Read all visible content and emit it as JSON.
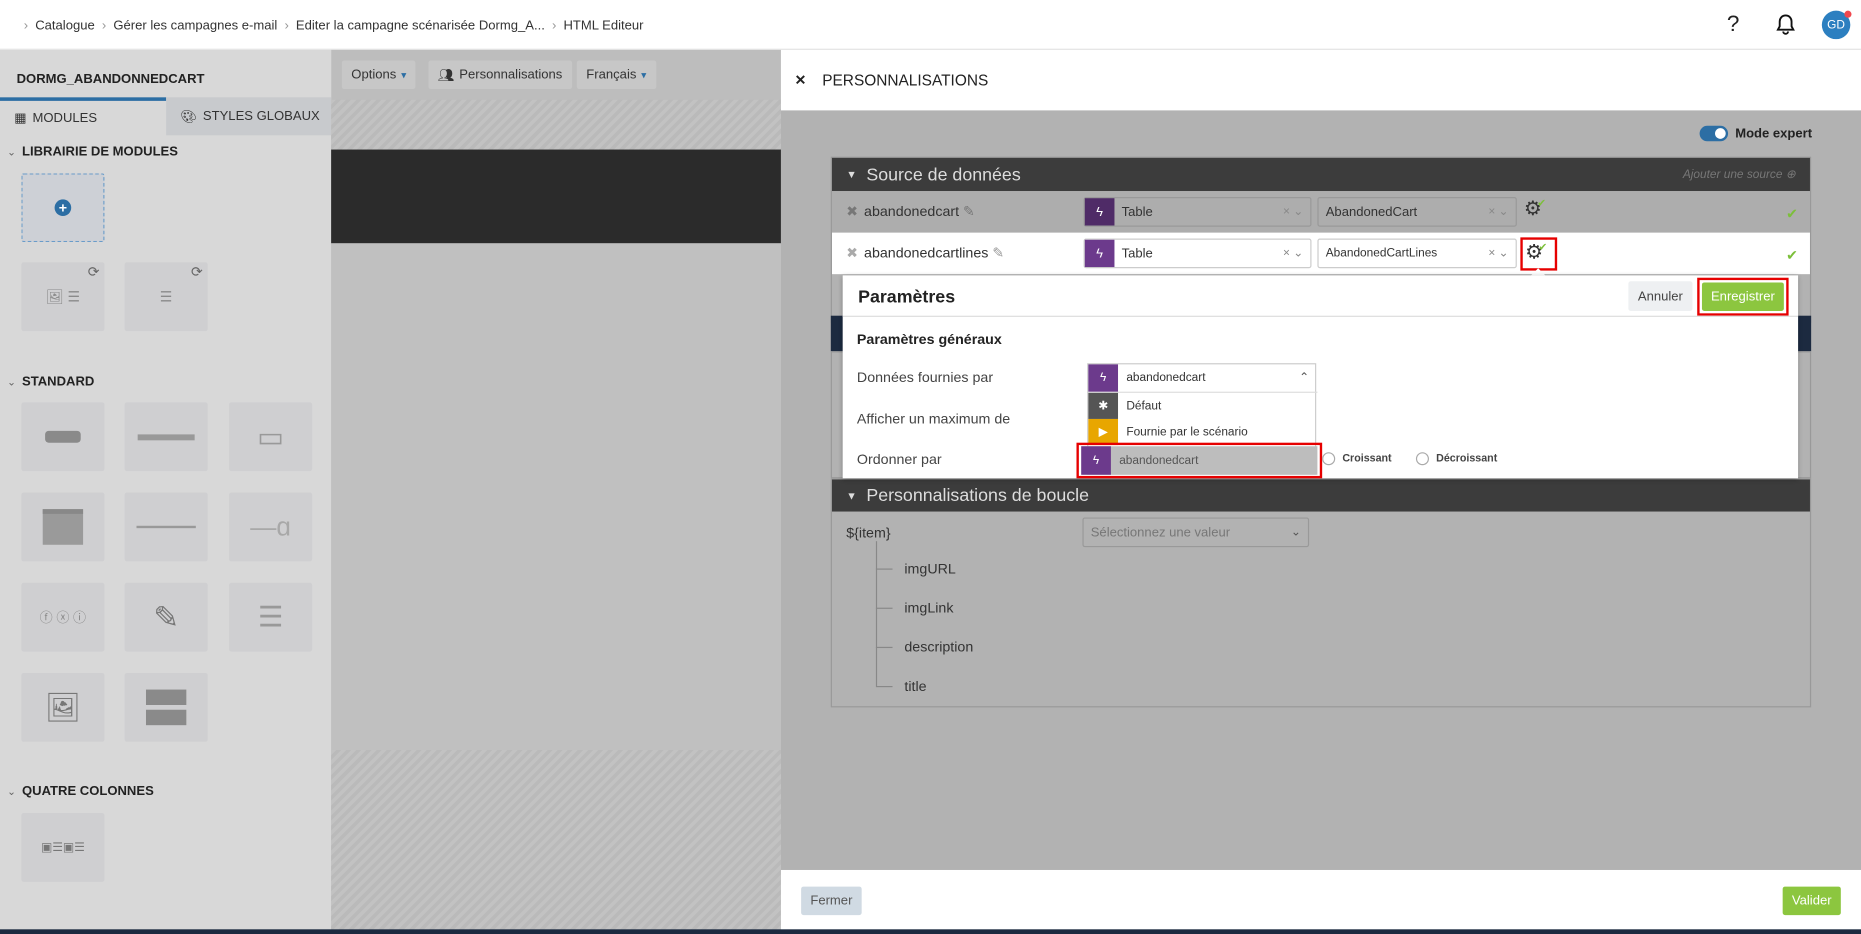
{
  "breadcrumb": [
    "Catalogue",
    "Gérer les campagnes e-mail",
    "Editer la campagne scénarisée Dormg_A...",
    "HTML Editeur"
  ],
  "header": {
    "help_icon": "question-icon",
    "notif_icon": "bell-icon",
    "avatar": "GD"
  },
  "sidebar": {
    "title": "DORMG_ABANDONNEDCART",
    "tabs": [
      {
        "label": "MODULES",
        "active": true
      },
      {
        "label": "STYLES GLOBAUX",
        "active": false
      }
    ],
    "sections": {
      "library": "LIBRAIRIE DE MODULES",
      "standard": "STANDARD",
      "four_columns": "QUATRE COLONNES"
    }
  },
  "editor_toolbar": {
    "options": "Options",
    "personalisations": "Personnalisations",
    "language": "Français"
  },
  "panel": {
    "title": "PERSONNALISATIONS",
    "mode_expert": {
      "label": "Mode expert",
      "on": true
    },
    "data_source": {
      "title": "Source de données",
      "add_source": "Ajouter une source",
      "rows": [
        {
          "name": "abandonedcart",
          "type": "Table",
          "table": "AbandonedCart"
        },
        {
          "name": "abandonedcartlines",
          "type": "Table",
          "table": "AbandonedCartLines"
        }
      ]
    },
    "params": {
      "title": "Paramètres",
      "cancel": "Annuler",
      "save": "Enregistrer",
      "general": "Paramètres généraux",
      "provided_by_label": "Données fournies par",
      "provided_by_value": "abandonedcart",
      "options": [
        "Défaut",
        "Fournie par le scénario",
        "abandonedcart"
      ],
      "max_label": "Afficher un maximum de",
      "order_label": "Ordonner par",
      "asc": "Croissant",
      "desc": "Décroissant"
    },
    "loop": {
      "title": "Personnalisations de boucle",
      "item": "${item}",
      "placeholder": "Sélectionnez une valeur",
      "fields": [
        "imgURL",
        "imgLink",
        "description",
        "title"
      ]
    },
    "close": "Fermer",
    "validate": "Valider"
  },
  "colors": {
    "accent": "#2c6ea4",
    "save_green": "#8cc63f",
    "purple": "#6c3a8c",
    "highlight": "#e60000"
  }
}
